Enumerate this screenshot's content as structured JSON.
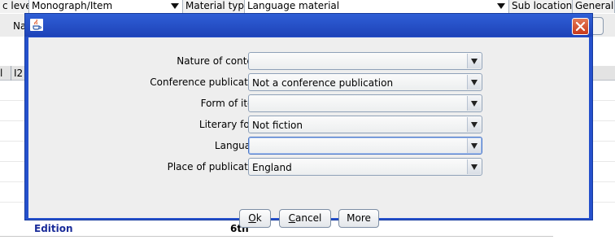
{
  "background": {
    "header_cells": [
      {
        "label": "c level",
        "combo": false
      },
      {
        "label": "Monograph/Item",
        "combo": true
      },
      {
        "label": "Material type",
        "combo": false
      },
      {
        "label": "Language material",
        "combo": true
      },
      {
        "label": "Sub location",
        "combo": false
      },
      {
        "label": "General l",
        "combo": false
      }
    ],
    "row2_label": "Na",
    "column_headers": [
      "l",
      "I2"
    ],
    "edition_label": "Edition",
    "edition_value": "6th"
  },
  "dialog": {
    "title": "",
    "fields": [
      {
        "label": "Nature of content :",
        "value": ""
      },
      {
        "label": "Conference publication :",
        "value": "Not a conference publication"
      },
      {
        "label": "Form of item :",
        "value": ""
      },
      {
        "label": "Literary form :",
        "value": "Not fiction"
      },
      {
        "label": "Language :",
        "value": ""
      },
      {
        "label": "Place of publication :",
        "value": "England"
      }
    ],
    "buttons": {
      "ok": {
        "mnemonic": "O",
        "rest": "k"
      },
      "cancel": {
        "mnemonic": "C",
        "rest": "ancel"
      },
      "more": "More"
    }
  },
  "colors": {
    "titlebar": "#2550cc",
    "close_button": "#d2512d",
    "edition_label": "#1a2c99",
    "dialog_background": "#eeeeee"
  },
  "icons": {
    "title_icon": "java-cup-icon",
    "close_icon": "close-icon",
    "dropdown_icon": "chevron-down-icon"
  }
}
